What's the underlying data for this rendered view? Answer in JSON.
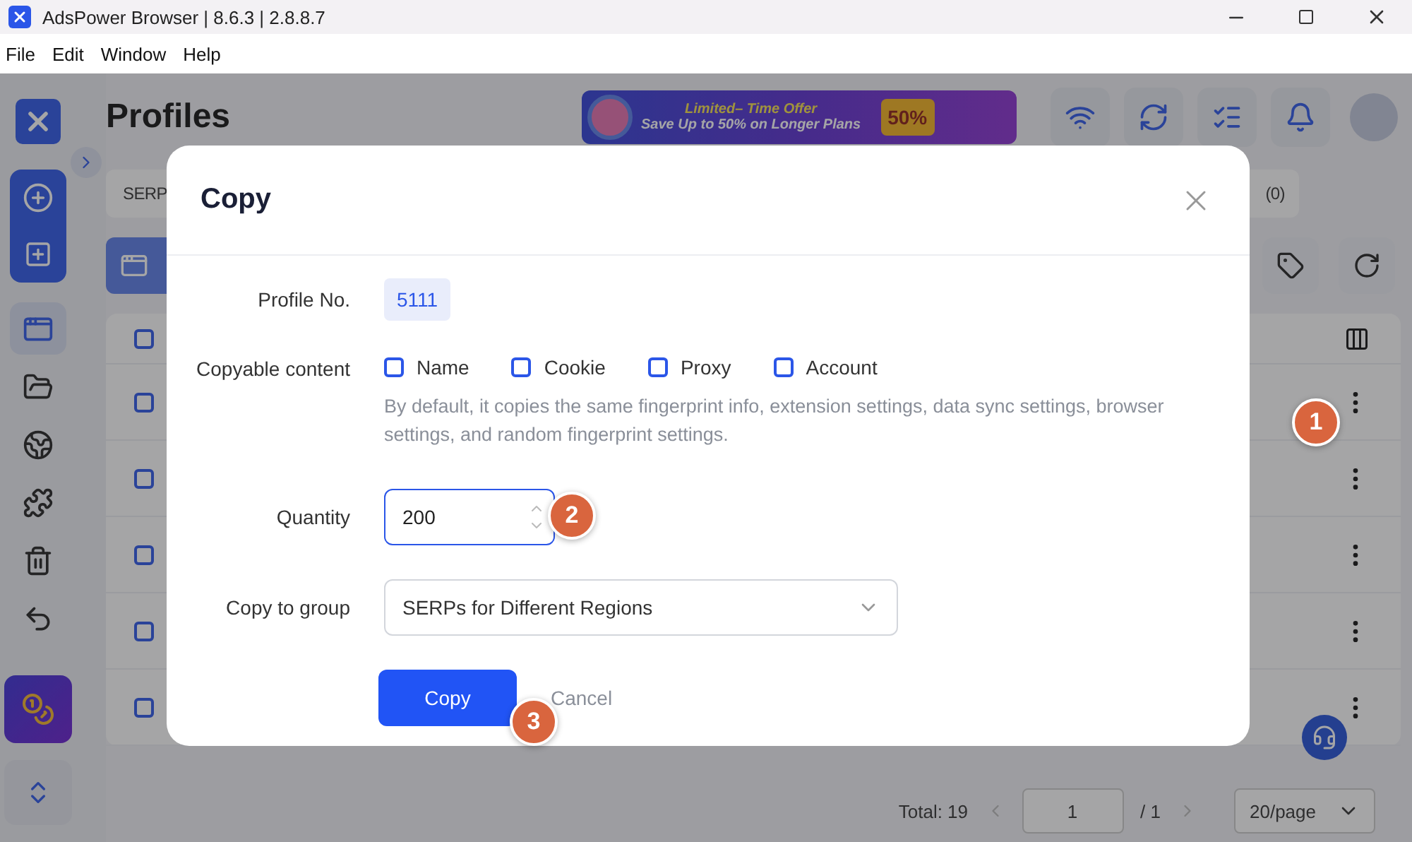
{
  "window": {
    "title": "AdsPower Browser | 8.6.3 | 2.8.8.7"
  },
  "menu": [
    "File",
    "Edit",
    "Window",
    "Help"
  ],
  "sidebar": {
    "nav": [
      {
        "selected": true
      },
      {
        "selected": false
      },
      {
        "selected": false
      },
      {
        "selected": false
      },
      {
        "selected": false
      },
      {
        "selected": false
      }
    ]
  },
  "header": {
    "title": "Profiles",
    "promo": {
      "line_1": "Limited– Time Offer",
      "line_2": "Save Up to 50% on Longer Plans",
      "badge": "50%"
    }
  },
  "group_bar": {
    "group": "SERP",
    "count": "(0)"
  },
  "table": {
    "rows": [
      {
        "checked": false
      },
      {
        "checked": false
      },
      {
        "checked": false
      },
      {
        "checked": false
      },
      {
        "checked": false
      }
    ],
    "header_checked": false
  },
  "pagination": {
    "total": "Total: 19",
    "page": "1",
    "of": "/ 1",
    "page_size": "20/page"
  },
  "dialog": {
    "title": "Copy",
    "profile_label": "Profile No.",
    "profile_no": "5111",
    "content_label": "Copyable content",
    "options": [
      {
        "label": "Name",
        "checked": false
      },
      {
        "label": "Cookie",
        "checked": false
      },
      {
        "label": "Proxy",
        "checked": false
      },
      {
        "label": "Account",
        "checked": false
      }
    ],
    "hint": "By default, it copies the same fingerprint info, extension settings, data sync settings, browser settings, and random fingerprint settings.",
    "quantity_label": "Quantity",
    "quantity": "200",
    "group_label": "Copy to group",
    "group": "SERPs for Different Regions",
    "confirm": "Copy",
    "cancel": "Cancel"
  },
  "annotations": [
    "1",
    "2",
    "3"
  ]
}
